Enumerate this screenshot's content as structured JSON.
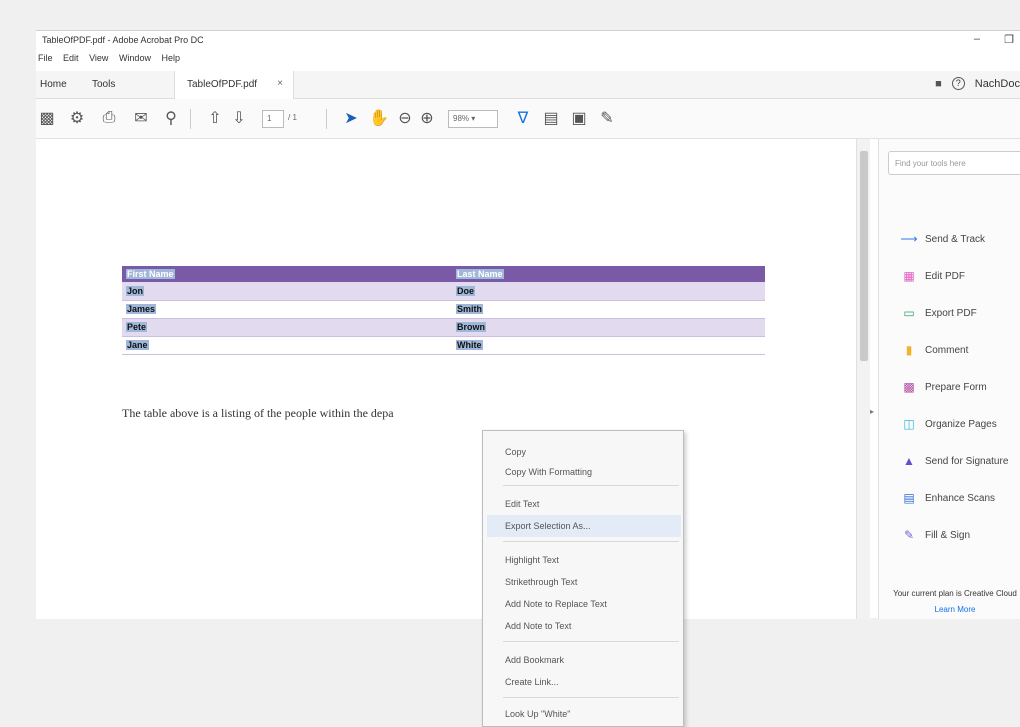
{
  "window": {
    "title": "TableOfPDF.pdf - Adobe Acrobat Pro DC",
    "min": "–",
    "restore": "❐"
  },
  "menu": [
    "File",
    "Edit",
    "View",
    "Window",
    "Help"
  ],
  "tabs": {
    "home": "Home",
    "tools": "Tools",
    "doc": "TableOfPDF.pdf",
    "close": "×"
  },
  "header_right": {
    "user": "NachDoc"
  },
  "toolbar": {
    "page_current": "1",
    "page_total": "/ 1",
    "zoom": "98%"
  },
  "table": {
    "headers": [
      "First Name",
      "Last Name"
    ],
    "rows": [
      [
        "Jon",
        "Doe"
      ],
      [
        "James",
        "Smith"
      ],
      [
        "Pete",
        "Brown"
      ],
      [
        "Jane",
        "White"
      ]
    ]
  },
  "document": {
    "sentence": "The table above is a listing of the people within the depa"
  },
  "context_menu": {
    "items": [
      "Copy",
      "Copy With Formatting",
      "Edit Text",
      "Export Selection As...",
      "Highlight Text",
      "Strikethrough Text",
      "Add Note to Replace Text",
      "Add Note to Text",
      "Add Bookmark",
      "Create Link...",
      "Look Up \"White\""
    ],
    "hovered": "Export Selection As..."
  },
  "right_panel": {
    "search_placeholder": "Find your tools here",
    "tools": [
      {
        "label": "Send & Track",
        "icon": "send-track-icon",
        "color": "#2d7be5"
      },
      {
        "label": "Edit PDF",
        "icon": "edit-pdf-icon",
        "color": "#e05ac0"
      },
      {
        "label": "Export PDF",
        "icon": "export-pdf-icon",
        "color": "#2ea86b"
      },
      {
        "label": "Comment",
        "icon": "comment-icon",
        "color": "#f0b429"
      },
      {
        "label": "Prepare Form",
        "icon": "prepare-form-icon",
        "color": "#b04aa0"
      },
      {
        "label": "Organize Pages",
        "icon": "organize-pages-icon",
        "color": "#2db5d5"
      },
      {
        "label": "Send for Signature",
        "icon": "send-signature-icon",
        "color": "#6a4bc9"
      },
      {
        "label": "Enhance Scans",
        "icon": "enhance-scans-icon",
        "color": "#2b6fd6"
      },
      {
        "label": "Fill & Sign",
        "icon": "fill-sign-icon",
        "color": "#7b5bd6"
      }
    ],
    "plan_text": "Your current plan is Creative Cloud",
    "learn_more": "Learn More"
  }
}
